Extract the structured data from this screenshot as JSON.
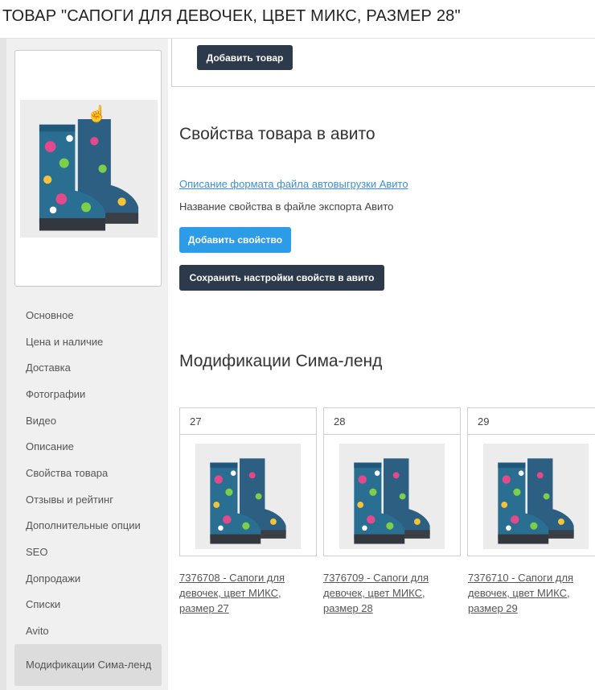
{
  "header": {
    "title": "ТОВАР \"САПОГИ ДЛЯ ДЕВОЧЕК, ЦВЕТ МИКС, РАЗМЕР 28\""
  },
  "product_image": {
    "icon": "boots-image"
  },
  "sidebar": {
    "items": [
      {
        "label": "Основное",
        "active": false
      },
      {
        "label": "Цена и наличие",
        "active": false
      },
      {
        "label": "Доставка",
        "active": false
      },
      {
        "label": "Фотографии",
        "active": false
      },
      {
        "label": "Видео",
        "active": false
      },
      {
        "label": "Описание",
        "active": false
      },
      {
        "label": "Свойства товара",
        "active": false
      },
      {
        "label": "Отзывы и рейтинг",
        "active": false
      },
      {
        "label": "Дополнительные опции",
        "active": false
      },
      {
        "label": "SEO",
        "active": false
      },
      {
        "label": "Допродажи",
        "active": false
      },
      {
        "label": "Списки",
        "active": false
      },
      {
        "label": "Avito",
        "active": false
      },
      {
        "label": "Модификации Сима-ленд",
        "active": true
      }
    ]
  },
  "top_panel": {
    "add_product_label": "Добавить товар"
  },
  "avito": {
    "title": "Свойства товара в авито",
    "format_link": "Описание формата файла автовыгрузки Авито",
    "property_label": "Название свойства в файле экспорта Авито",
    "add_property_label": "Добавить свойство",
    "save_settings_label": "Сохранить настройки свойств в авито"
  },
  "sima": {
    "title": "Модификации Сима-ленд",
    "modifications": [
      {
        "size": "27",
        "link": "7376708 - Сапоги для девочек, цвет МИКС, размер 27"
      },
      {
        "size": "28",
        "link": "7376709 - Сапоги для девочек, цвет МИКС, размер 28"
      },
      {
        "size": "29",
        "link": "7376710 - Сапоги для девочек, цвет МИКС, размер 29"
      }
    ]
  },
  "colors": {
    "dark_button": "#2c3a4b",
    "blue_button": "#2d9ce8",
    "link": "#3a8fd8",
    "sidebar_bg": "#f0f0f0"
  }
}
